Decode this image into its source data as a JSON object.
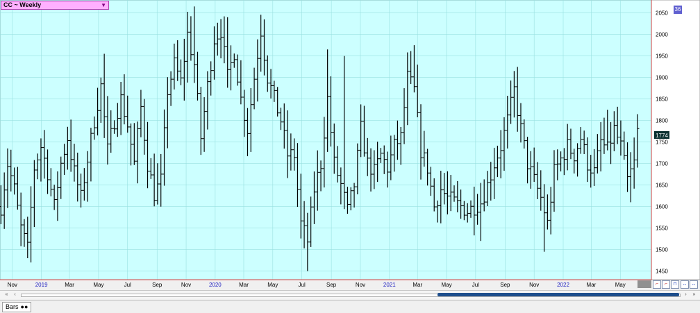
{
  "header": {
    "symbol_label": "CC ~ Weekly",
    "corner_badge": "36"
  },
  "footer": {
    "tab_label": "Bars"
  },
  "colors": {
    "plot_bg": "#ccffff",
    "grid": "#99e0e0",
    "bar": "#000000",
    "axis_bg": "#ffffff",
    "price_tag_bg": "#0a3030",
    "x_label_year": "#2020c0",
    "x_label_month": "#000000"
  },
  "chart_data": {
    "type": "ohlc",
    "title": "CC ~ Weekly",
    "y_axis": {
      "min": 1450,
      "max": 2050,
      "tick_step": 50,
      "side": "right",
      "ticks": [
        "1450",
        "1500",
        "1550",
        "1600",
        "1650",
        "1700",
        "1750",
        "1800",
        "1850",
        "1900",
        "1950",
        "2000",
        "2050"
      ]
    },
    "last_price": "1774",
    "x_axis": {
      "labels": [
        {
          "text": "Nov",
          "kind": "month",
          "date": "2018-11"
        },
        {
          "text": "2019",
          "kind": "year",
          "date": "2019-01"
        },
        {
          "text": "Mar",
          "kind": "month",
          "date": "2019-03"
        },
        {
          "text": "May",
          "kind": "month",
          "date": "2019-05"
        },
        {
          "text": "Jul",
          "kind": "month",
          "date": "2019-07"
        },
        {
          "text": "Sep",
          "kind": "month",
          "date": "2019-09"
        },
        {
          "text": "Nov",
          "kind": "month",
          "date": "2019-11"
        },
        {
          "text": "2020",
          "kind": "year",
          "date": "2020-01"
        },
        {
          "text": "Mar",
          "kind": "month",
          "date": "2020-03"
        },
        {
          "text": "May",
          "kind": "month",
          "date": "2020-05"
        },
        {
          "text": "Jul",
          "kind": "month",
          "date": "2020-07"
        },
        {
          "text": "Sep",
          "kind": "month",
          "date": "2020-09"
        },
        {
          "text": "Nov",
          "kind": "month",
          "date": "2020-11"
        },
        {
          "text": "2021",
          "kind": "year",
          "date": "2021-01"
        },
        {
          "text": "Mar",
          "kind": "month",
          "date": "2021-03"
        },
        {
          "text": "May",
          "kind": "month",
          "date": "2021-05"
        },
        {
          "text": "Jul",
          "kind": "month",
          "date": "2021-07"
        },
        {
          "text": "Sep",
          "kind": "month",
          "date": "2021-09"
        },
        {
          "text": "Nov",
          "kind": "month",
          "date": "2021-11"
        },
        {
          "text": "2022",
          "kind": "year",
          "date": "2022-01"
        },
        {
          "text": "Mar",
          "kind": "month",
          "date": "2022-03"
        },
        {
          "text": "May",
          "kind": "month",
          "date": "2022-05"
        }
      ]
    },
    "grid": true,
    "waypoints": [
      [
        "2018-10-08",
        1600
      ],
      [
        "2018-10-22",
        1700
      ],
      [
        "2018-11-05",
        1640
      ],
      [
        "2018-11-19",
        1550
      ],
      [
        "2018-12-03",
        1500
      ],
      [
        "2018-12-17",
        1690
      ],
      [
        "2018-12-31",
        1740
      ],
      [
        "2019-01-14",
        1680
      ],
      [
        "2019-01-28",
        1600
      ],
      [
        "2019-02-11",
        1700
      ],
      [
        "2019-02-25",
        1760
      ],
      [
        "2019-03-11",
        1680
      ],
      [
        "2019-03-25",
        1620
      ],
      [
        "2019-04-08",
        1710
      ],
      [
        "2019-04-22",
        1800
      ],
      [
        "2019-05-06",
        1880
      ],
      [
        "2019-05-20",
        1730
      ],
      [
        "2019-06-03",
        1800
      ],
      [
        "2019-06-17",
        1850
      ],
      [
        "2019-07-01",
        1790
      ],
      [
        "2019-07-15",
        1700
      ],
      [
        "2019-07-29",
        1830
      ],
      [
        "2019-08-12",
        1700
      ],
      [
        "2019-08-26",
        1630
      ],
      [
        "2019-09-09",
        1660
      ],
      [
        "2019-09-23",
        1870
      ],
      [
        "2019-10-07",
        1930
      ],
      [
        "2019-10-21",
        1890
      ],
      [
        "2019-11-04",
        2000
      ],
      [
        "2019-11-18",
        1930
      ],
      [
        "2019-12-02",
        1760
      ],
      [
        "2019-12-16",
        1880
      ],
      [
        "2019-12-30",
        1990
      ],
      [
        "2020-01-13",
        2010
      ],
      [
        "2020-01-27",
        1900
      ],
      [
        "2020-02-10",
        1960
      ],
      [
        "2020-02-24",
        1850
      ],
      [
        "2020-03-09",
        1780
      ],
      [
        "2020-03-23",
        1900
      ],
      [
        "2020-04-06",
        2010
      ],
      [
        "2020-04-20",
        1900
      ],
      [
        "2020-05-04",
        1850
      ],
      [
        "2020-05-18",
        1800
      ],
      [
        "2020-06-01",
        1720
      ],
      [
        "2020-06-15",
        1720
      ],
      [
        "2020-06-29",
        1560
      ],
      [
        "2020-07-13",
        1520
      ],
      [
        "2020-07-27",
        1640
      ],
      [
        "2020-08-10",
        1700
      ],
      [
        "2020-08-24",
        1850
      ],
      [
        "2020-09-07",
        1700
      ],
      [
        "2020-09-21",
        1650
      ],
      [
        "2020-10-05",
        1590
      ],
      [
        "2020-10-19",
        1650
      ],
      [
        "2020-11-02",
        1780
      ],
      [
        "2020-11-16",
        1700
      ],
      [
        "2020-11-30",
        1680
      ],
      [
        "2020-12-14",
        1720
      ],
      [
        "2020-12-28",
        1690
      ],
      [
        "2021-01-11",
        1740
      ],
      [
        "2021-01-25",
        1760
      ],
      [
        "2021-02-08",
        1900
      ],
      [
        "2021-02-22",
        1870
      ],
      [
        "2021-03-08",
        1730
      ],
      [
        "2021-03-22",
        1690
      ],
      [
        "2021-04-05",
        1600
      ],
      [
        "2021-04-19",
        1640
      ],
      [
        "2021-05-03",
        1620
      ],
      [
        "2021-05-17",
        1610
      ],
      [
        "2021-05-31",
        1600
      ],
      [
        "2021-06-14",
        1590
      ],
      [
        "2021-06-28",
        1600
      ],
      [
        "2021-07-12",
        1610
      ],
      [
        "2021-07-26",
        1650
      ],
      [
        "2021-08-09",
        1700
      ],
      [
        "2021-08-23",
        1740
      ],
      [
        "2021-09-06",
        1800
      ],
      [
        "2021-09-20",
        1870
      ],
      [
        "2021-10-04",
        1780
      ],
      [
        "2021-10-18",
        1700
      ],
      [
        "2021-11-01",
        1660
      ],
      [
        "2021-11-15",
        1620
      ],
      [
        "2021-11-29",
        1560
      ],
      [
        "2021-12-13",
        1680
      ],
      [
        "2021-12-27",
        1710
      ],
      [
        "2022-01-10",
        1740
      ],
      [
        "2022-01-24",
        1720
      ],
      [
        "2022-02-07",
        1760
      ],
      [
        "2022-02-21",
        1700
      ],
      [
        "2022-03-07",
        1680
      ],
      [
        "2022-03-21",
        1750
      ],
      [
        "2022-04-04",
        1730
      ],
      [
        "2022-04-18",
        1780
      ],
      [
        "2022-05-02",
        1740
      ],
      [
        "2022-05-16",
        1660
      ],
      [
        "2022-05-30",
        1700
      ],
      [
        "2022-06-06",
        1774
      ]
    ],
    "extremes": [
      [
        "2018-12-10",
        1470,
        "L"
      ],
      [
        "2019-05-13",
        1955,
        "H"
      ],
      [
        "2019-11-18",
        2065,
        "H"
      ],
      [
        "2020-01-27",
        2040,
        "H"
      ],
      [
        "2020-04-13",
        2035,
        "H"
      ],
      [
        "2020-07-13",
        1450,
        "L"
      ],
      [
        "2020-08-24",
        1965,
        "H"
      ],
      [
        "2020-09-28",
        1950,
        "H"
      ],
      [
        "2021-02-22",
        1975,
        "H"
      ],
      [
        "2021-07-12",
        1520,
        "L"
      ],
      [
        "2021-09-20",
        1915,
        "H"
      ],
      [
        "2021-11-22",
        1495,
        "L"
      ],
      [
        "2022-04-04",
        1825,
        "H"
      ],
      [
        "2022-05-23",
        1610,
        "L"
      ]
    ]
  }
}
